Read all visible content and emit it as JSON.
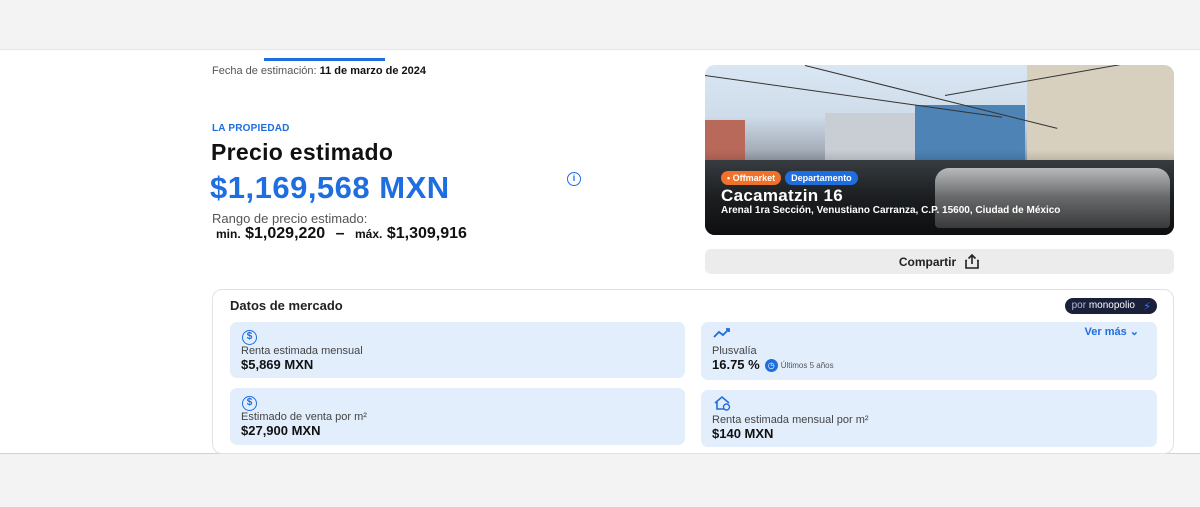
{
  "header": {
    "estimation_date_label": "Fecha de estimación:",
    "estimation_date": "11 de marzo de 2024"
  },
  "summary": {
    "kicker": "LA PROPIEDAD",
    "title": "Precio estimado",
    "price": "$1,169,568 MXN",
    "info_icon": "i",
    "range_label": "Rango de precio estimado:",
    "min_label": "min.",
    "min_value": "$1,029,220",
    "separator": "–",
    "max_label": "máx.",
    "max_value": "$1,309,916"
  },
  "property": {
    "tags": [
      "• Offmarket",
      "Departamento"
    ],
    "name": "Cacamatzin 16",
    "address": "Arenal 1ra Sección, Venustiano Carranza, C.P. 15600, Ciudad de México",
    "share_label": "Compartir",
    "share_icon": "share-icon"
  },
  "market": {
    "title": "Datos de mercado",
    "badge_prefix": "por",
    "badge_brand": "monopolio",
    "see_more": "Ver más",
    "tiles": {
      "monthly_rent": {
        "icon": "dollar-coin-icon",
        "label": "Renta estimada mensual",
        "value": "$5,869 MXN"
      },
      "appreciation": {
        "icon": "trend-line-icon",
        "label": "Plusvalía",
        "value": "16.75 %",
        "period": "Últimos 5 años"
      },
      "sale_per_m2": {
        "icon": "dollar-coin-icon",
        "label": "Estimado de venta por m²",
        "value": "$27,900 MXN"
      },
      "rent_per_m2": {
        "icon": "house-dollar-icon",
        "label": "Renta estimada mensual por m²",
        "value": "$140 MXN"
      }
    }
  },
  "colors": {
    "accent": "#1e6ee0",
    "tile_bg": "#e3eefc",
    "tag_orange": "#f0712a",
    "badge_bg": "#1a1f3a"
  }
}
